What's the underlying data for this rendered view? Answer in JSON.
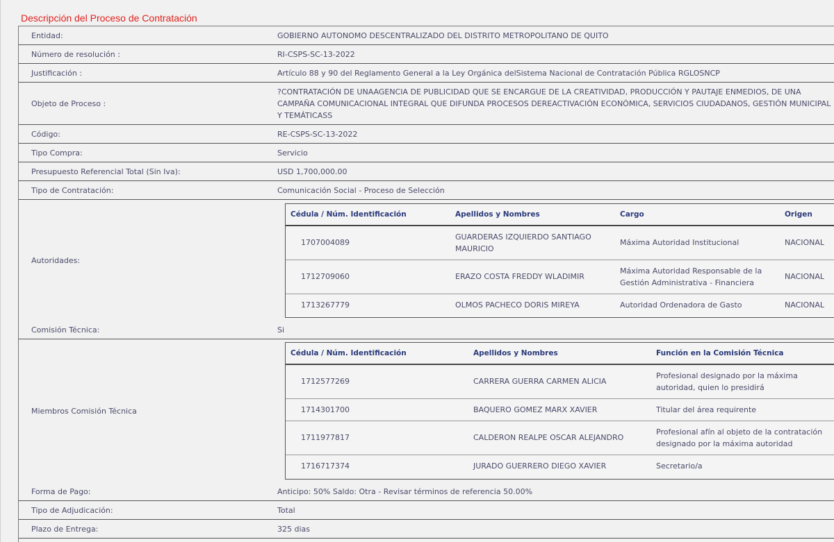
{
  "section_title": "Descripción del Proceso de Contratación",
  "fields": {
    "entidad": {
      "label": "Entidad:",
      "value": "GOBIERNO AUTONOMO DESCENTRALIZADO DEL DISTRITO METROPOLITANO DE QUITO"
    },
    "numero_resolucion": {
      "label": "Número de resolución :",
      "value": "RI-CSPS-SC-13-2022"
    },
    "justificacion": {
      "label": "Justificación :",
      "value": "Artículo 88 y 90 del Reglamento General a la Ley Orgánica delSistema Nacional de Contratación Pública RGLOSNCP"
    },
    "objeto": {
      "label": "Objeto de Proceso :",
      "value": "?CONTRATACIÓN DE UNAAGENCIA DE PUBLICIDAD QUE SE ENCARGUE DE LA CREATIVIDAD, PRODUCCIÓN Y PAUTAJE ENMEDIOS, DE UNA CAMPAÑA COMUNICACIONAL INTEGRAL QUE DIFUNDA PROCESOS DEREACTIVACIÓN ECONÓMICA, SERVICIOS CIUDADANOS, GESTIÓN MUNICIPAL Y TEMÁTICASS"
    },
    "codigo": {
      "label": "Código:",
      "value": "RE-CSPS-SC-13-2022"
    },
    "tipo_compra": {
      "label": "Tipo Compra:",
      "value": "Servicio"
    },
    "presupuesto": {
      "label": "Presupuesto Referencial Total (Sin Iva):",
      "value": "USD 1,700,000.00"
    },
    "tipo_contratacion": {
      "label": "Tipo de Contratación:",
      "value": "Comunicación Social - Proceso de Selección"
    },
    "autoridades": {
      "label": "Autoridades:"
    },
    "comision": {
      "label": "Comisión Técnica:",
      "value": "Si"
    },
    "miembros": {
      "label": "Miembros Comisión Técnica"
    },
    "forma_pago": {
      "label": "Forma de Pago:",
      "value": "Anticipo: 50% Saldo: Otra - Revisar términos de referencia 50.00%"
    },
    "tipo_adjudicacion": {
      "label": "Tipo de Adjudicación:",
      "value": "Total"
    },
    "plazo": {
      "label": "Plazo de Entrega:",
      "value": "325 dias"
    }
  },
  "autoridades_table": {
    "headers": [
      "Cédula / Núm. Identificación",
      "Apellidos y Nombres",
      "Cargo",
      "Origen"
    ],
    "rows": [
      [
        "1707004089",
        "GUARDERAS IZQUIERDO SANTIAGO MAURICIO",
        "Máxima Autoridad Institucional",
        "NACIONAL"
      ],
      [
        "1712709060",
        "ERAZO COSTA FREDDY WLADIMIR",
        "Máxima Autoridad Responsable de la Gestión Administrativa - Financiera",
        "NACIONAL"
      ],
      [
        "1713267779",
        "OLMOS PACHECO DORIS MIREYA",
        "Autoridad Ordenadora de Gasto",
        "NACIONAL"
      ]
    ]
  },
  "comision_table": {
    "headers": [
      "Cédula / Núm. Identificación",
      "Apellidos y Nombres",
      "Función en la Comisión Técnica"
    ],
    "rows": [
      [
        "1712577269",
        "CARRERA GUERRA CARMEN ALICIA",
        "Profesional designado por la máxima autoridad, quien lo presidirá"
      ],
      [
        "1714301700",
        "BAQUERO GOMEZ MARX XAVIER",
        "Titular del área requirente"
      ],
      [
        "1711977817",
        "CALDERON REALPE OSCAR ALEJANDRO",
        "Profesional afín al objeto de la contratación designado por la máxima autoridad"
      ],
      [
        "1716717374",
        "JURADO GUERRERO DIEGO XAVIER",
        "Secretario/a"
      ]
    ]
  }
}
